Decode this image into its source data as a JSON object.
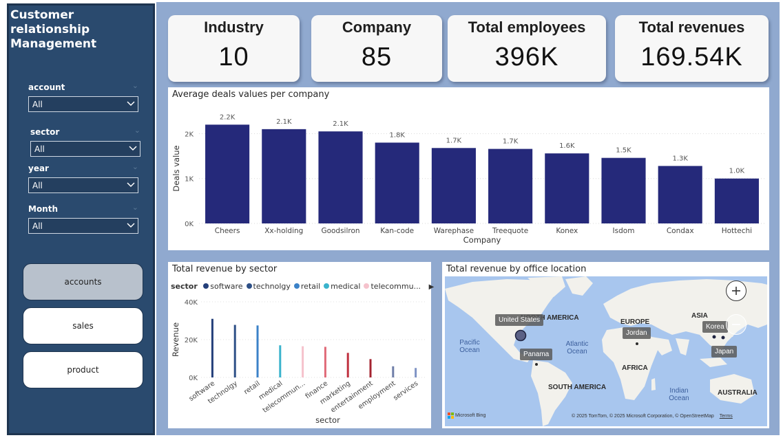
{
  "app": {
    "title": "Customer relationship Management"
  },
  "filters": [
    {
      "label": "account",
      "value": "All"
    },
    {
      "label": "sector",
      "value": "All"
    },
    {
      "label": "year",
      "value": "All"
    },
    {
      "label": "Month",
      "value": "All"
    }
  ],
  "nav": {
    "accounts": "accounts",
    "sales": "sales",
    "product": "product",
    "active": "accounts"
  },
  "kpis": [
    {
      "label": "Industry",
      "value": "10"
    },
    {
      "label": "Company",
      "value": "85"
    },
    {
      "label": "Total employees",
      "value": "396K"
    },
    {
      "label": "Total revenues",
      "value": "169.54K"
    }
  ],
  "bar_chart": {
    "title": "Average deals values per company",
    "chart_data": {
      "type": "bar",
      "title": "Average deals values per company",
      "xlabel": "Company",
      "ylabel": "Deals value",
      "categories": [
        "Cheers",
        "Xx-holding",
        "Goodsilron",
        "Kan-code",
        "Warephase",
        "Treequote",
        "Konex",
        "Isdom",
        "Condax",
        "Hottechi"
      ],
      "values": [
        2200,
        2100,
        2050,
        1800,
        1680,
        1660,
        1560,
        1460,
        1280,
        1000
      ],
      "data_labels": [
        "2.2K",
        "2.1K",
        "2.1K",
        "1.8K",
        "1.7K",
        "1.7K",
        "1.6K",
        "1.5K",
        "1.3K",
        "1.0K"
      ],
      "ylim": [
        0,
        2450
      ],
      "yticks": [
        0,
        1000,
        2000
      ],
      "ytick_labels": [
        "0K",
        "1K",
        "2K"
      ],
      "grid": true,
      "color": "#25297a"
    }
  },
  "sector_chart": {
    "title": "Total revenue by sector",
    "legend_title": "sector",
    "legend_items": [
      {
        "name": "software",
        "color": "#243f7a"
      },
      {
        "name": "technolgy",
        "color": "#2d4f86"
      },
      {
        "name": "retail",
        "color": "#3b82c8"
      },
      {
        "name": "medical",
        "color": "#3ab3cc"
      },
      {
        "name": "telecommu...",
        "color": "#f5c2cc"
      }
    ],
    "chart_data": {
      "type": "bar",
      "title": "Total revenue by sector",
      "xlabel": "sector",
      "ylabel": "Revenue",
      "categories": [
        "software",
        "technolgy",
        "retail",
        "medical",
        "telecommun...",
        "finance",
        "marketing",
        "entertainment",
        "employment",
        "services"
      ],
      "values": [
        31000,
        27800,
        27500,
        17000,
        16500,
        16200,
        13000,
        9700,
        5900,
        5000
      ],
      "colors": [
        "#243f7a",
        "#2d4f86",
        "#3b82c8",
        "#3ab3cc",
        "#f5c2cc",
        "#e06a78",
        "#c0313f",
        "#a42430",
        "#6f7ea8",
        "#7f93c4"
      ],
      "ylim": [
        0,
        40000
      ],
      "yticks": [
        0,
        20000,
        40000
      ],
      "ytick_labels": [
        "0K",
        "20K",
        "40K"
      ]
    }
  },
  "map": {
    "title": "Total revenue by office location",
    "continents": [
      "NORTH AMERICA",
      "EUROPE",
      "ASIA",
      "AFRICA",
      "SOUTH AMERICA",
      "AUSTRALIA"
    ],
    "oceans": [
      "Pacific Ocean",
      "Atlantic Ocean",
      "Indian Ocean"
    ],
    "locations": [
      "United States",
      "Panama",
      "Jordan",
      "Korea",
      "Japan"
    ],
    "attribution": "© 2025 TomTom, © 2025 Microsoft Corporation, © OpenStreetMap",
    "terms": "Terms",
    "brand": "Microsoft Bing"
  }
}
